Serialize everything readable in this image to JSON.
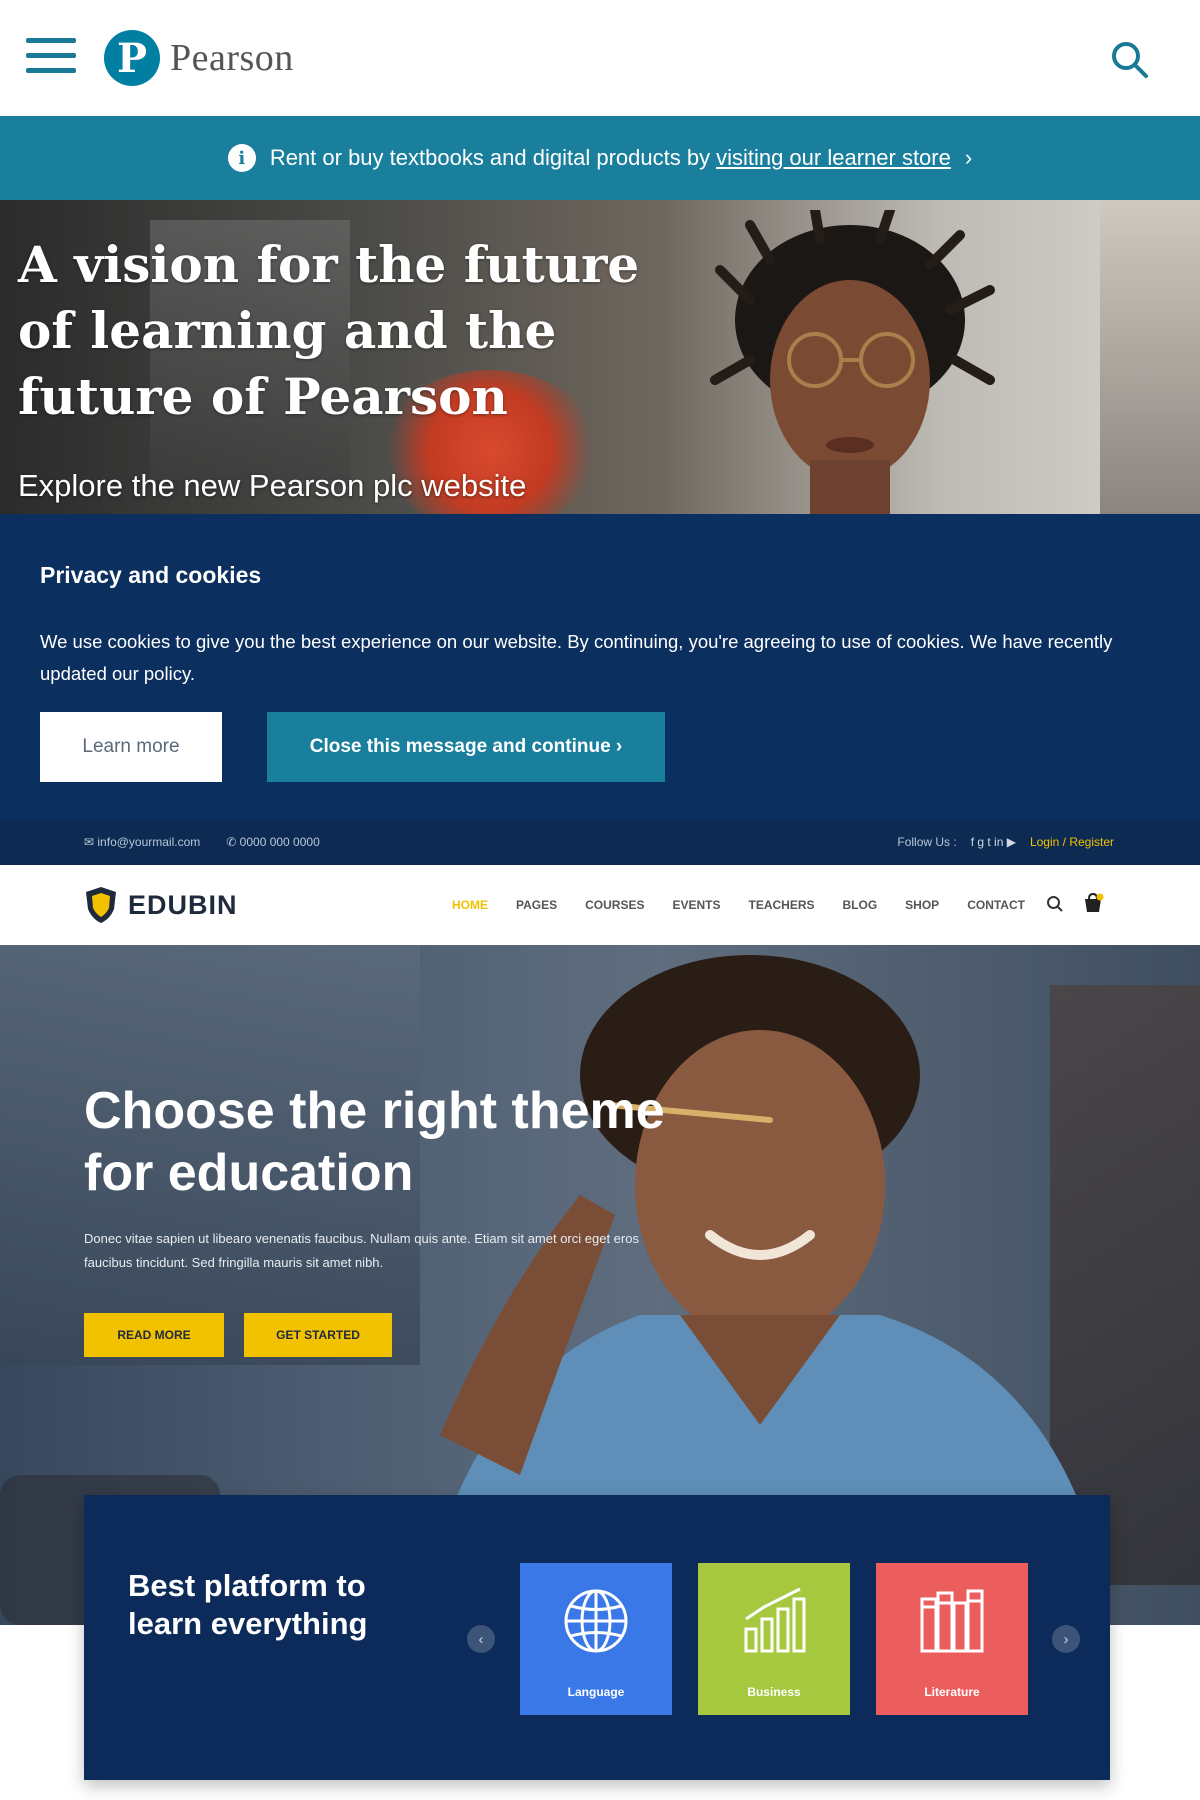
{
  "pearson": {
    "logo_letter": "P",
    "logo_text": "Pearson",
    "banner": {
      "info_icon": "i",
      "text": "Rent or buy textbooks and digital products by",
      "link": "visiting our learner store",
      "chevron": "›"
    },
    "hero": {
      "title": "A vision for the future of learning and the future of Pearson",
      "subtitle": "Explore the new Pearson plc website"
    },
    "cookies": {
      "title": "Privacy and cookies",
      "text": "We use cookies to give you the best experience on our website. By continuing, you're agreeing to use of cookies. We have recently updated our policy.",
      "learn_more": "Learn more",
      "close": "Close this message and continue ›"
    }
  },
  "edubin": {
    "topbar": {
      "email": "✉ info@yourmail.com",
      "phone": "✆ 0000 000 0000",
      "follow": "Follow Us :",
      "social": "f  g  t  in  ▶",
      "login": "Login / Register"
    },
    "logo_text": "EDUBIN",
    "menu": [
      "HOME",
      "PAGES",
      "COURSES",
      "EVENTS",
      "TEACHERS",
      "BLOG",
      "SHOP",
      "CONTACT"
    ],
    "hero": {
      "title": "Choose the right theme for education",
      "text": "Donec vitae sapien ut libearo venenatis faucibus. Nullam quis ante. Etiam sit amet orci eget eros faucibus tincidunt. Sed fringilla mauris sit amet nibh.",
      "read_more": "READ MORE",
      "get_started": "GET STARTED"
    },
    "platform": {
      "title": "Best platform to learn everything",
      "prev": "‹",
      "next": "›",
      "tiles": [
        {
          "label": "Language",
          "icon": "globe-icon",
          "color": "#3b78e7"
        },
        {
          "label": "Business",
          "icon": "bar-chart-icon",
          "color": "#a6c83f"
        },
        {
          "label": "Literature",
          "icon": "books-icon",
          "color": "#ec5d5d"
        }
      ]
    }
  },
  "colors": {
    "pearson_teal": "#1a7f9c",
    "pearson_navy": "#0b2f5e",
    "edubin_yellow": "#f2c200",
    "edubin_navy": "#0d2b5a"
  }
}
